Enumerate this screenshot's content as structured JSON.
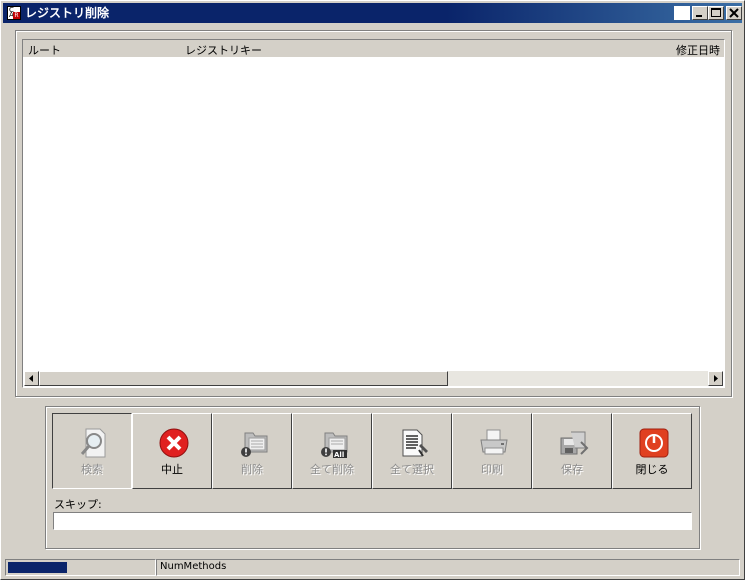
{
  "window": {
    "title": "レジストリ削除",
    "icon": "registry-app-icon",
    "controls": [
      "blank",
      "minimize",
      "maximize",
      "close"
    ]
  },
  "listview": {
    "columns": [
      {
        "label": "ルート"
      },
      {
        "label": "レジストリキー"
      },
      {
        "label": "修正日時"
      }
    ],
    "rows": []
  },
  "toolbar": {
    "buttons": [
      {
        "key": "search",
        "label": "検索",
        "enabled": false,
        "pressed": true,
        "icon": "magnifier-icon"
      },
      {
        "key": "stop",
        "label": "中止",
        "enabled": true,
        "pressed": false,
        "icon": "stop-x-icon",
        "color": "#e02020"
      },
      {
        "key": "delete",
        "label": "削除",
        "enabled": false,
        "pressed": false,
        "icon": "delete-folder-icon"
      },
      {
        "key": "delete-all",
        "label": "全て削除",
        "enabled": false,
        "pressed": false,
        "icon": "delete-all-folder-icon"
      },
      {
        "key": "select-all",
        "label": "全て選択",
        "enabled": false,
        "pressed": false,
        "icon": "select-all-document-icon"
      },
      {
        "key": "print",
        "label": "印刷",
        "enabled": false,
        "pressed": false,
        "icon": "printer-icon"
      },
      {
        "key": "save",
        "label": "保存",
        "enabled": false,
        "pressed": false,
        "icon": "save-disk-icon"
      },
      {
        "key": "close",
        "label": "閉じる",
        "enabled": true,
        "pressed": false,
        "icon": "power-icon",
        "color": "#e04020"
      }
    ]
  },
  "skip": {
    "label": "スキップ:",
    "value": ""
  },
  "statusbar": {
    "progress": 0.4,
    "text": "NumMethods"
  },
  "colors": {
    "face": "#d4d0c8",
    "title_active": "#0a246a",
    "progress": "#0a246a"
  }
}
